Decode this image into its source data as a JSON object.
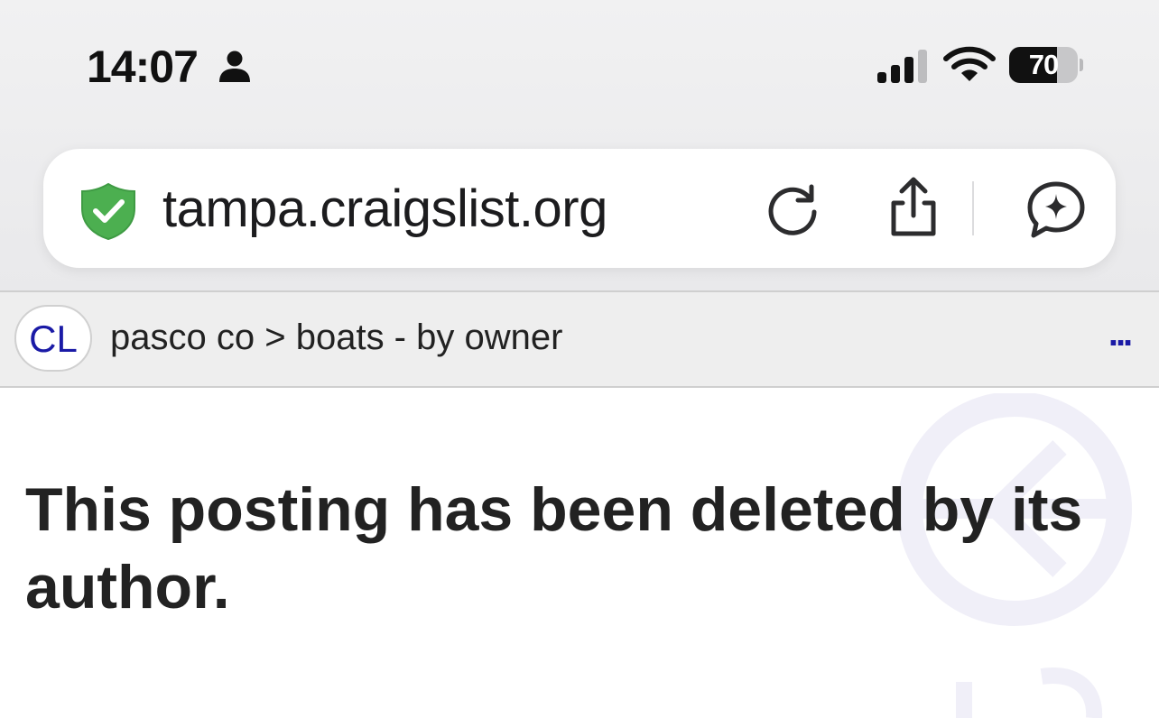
{
  "status_bar": {
    "time": "14:07",
    "battery_level": "70",
    "battery_fraction": 0.7,
    "icons": [
      "person-icon",
      "cellular-signal-icon",
      "wifi-icon",
      "battery-icon"
    ]
  },
  "browser": {
    "url": "tampa.craigslist.org",
    "security_icon": "green-shield-check-icon",
    "buttons": [
      "reload-icon",
      "share-icon",
      "assistant-sparkle-icon"
    ]
  },
  "site_header": {
    "logo_text": "CL",
    "breadcrumb": {
      "area": "pasco co",
      "separator": ">",
      "category": "boats - by owner"
    },
    "more_label": "..."
  },
  "content": {
    "message": "This posting has been deleted by its author."
  },
  "colors": {
    "chrome_bg": "#eeeeef",
    "link_blue": "#1a1aa6",
    "shield_green": "#4caf50",
    "text": "#222222"
  }
}
